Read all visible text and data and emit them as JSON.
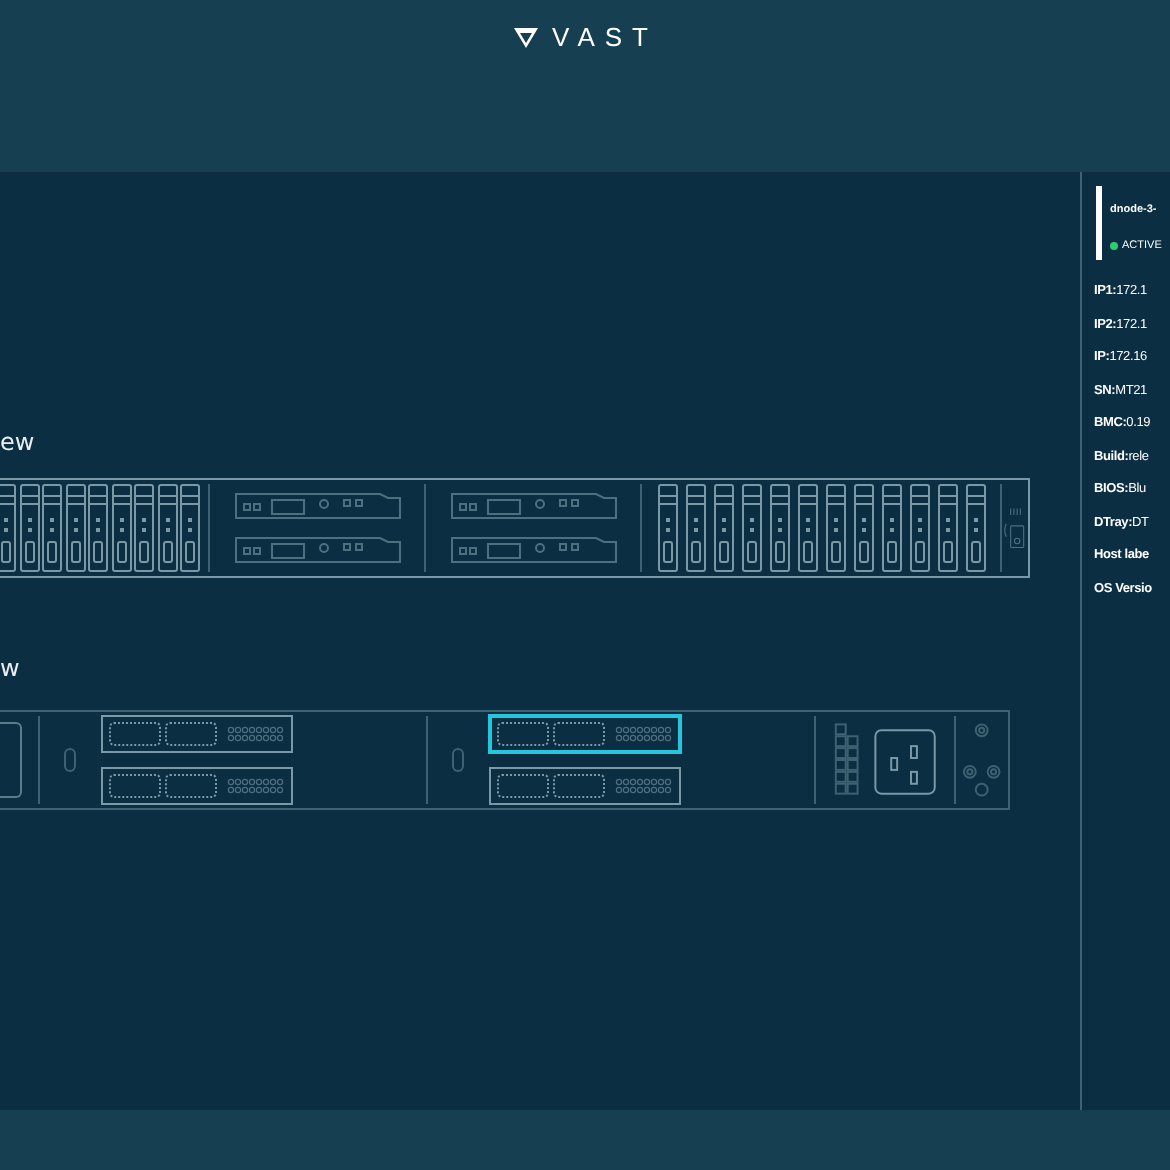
{
  "header": {
    "logo_text": "VAST"
  },
  "front_view": {
    "title": "ew"
  },
  "rear_view": {
    "title": "w",
    "slots": [
      {
        "nics": [
          {
            "selected": false
          },
          {
            "selected": false
          }
        ]
      },
      {
        "nics": [
          {
            "selected": true
          },
          {
            "selected": false
          }
        ]
      }
    ]
  },
  "node_panel": {
    "name": "dnode-3-",
    "status": {
      "label": "ACTIVE",
      "color": "#2ecc71"
    },
    "fields": [
      {
        "label": "IP1:",
        "value": "172.1"
      },
      {
        "label": "IP2:",
        "value": "172.1"
      },
      {
        "label": "IP:",
        "value": "172.16"
      },
      {
        "label": "SN:",
        "value": "MT21"
      },
      {
        "label": "BMC:",
        "value": "0.19"
      },
      {
        "label": "Build:",
        "value": "rele"
      },
      {
        "label": "BIOS:",
        "value": "Blu"
      },
      {
        "label": "DTray:",
        "value": "DT"
      },
      {
        "label": "Host labe"
      },
      {
        "label": "OS Versio"
      }
    ]
  }
}
